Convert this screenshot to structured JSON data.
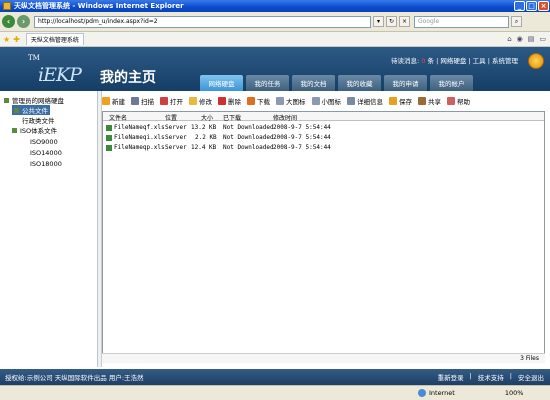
{
  "window": {
    "title": "天纵文档管理系统 - Windows Internet Explorer"
  },
  "browser": {
    "address": "http://localhost/pdm_u/index.aspx?id=2",
    "search_placeholder": "Google",
    "tab_title": "天纵文档管理系统",
    "status_zone": "Internet",
    "zoom": "100%"
  },
  "header": {
    "logo_tm": "TM",
    "logo_brand": "iEKP",
    "logo_home": "我的主页",
    "msg_prefix": "待读消息:",
    "msg_count": "0",
    "msg_suffix": "条",
    "links": "| 网络硬盘 | 工具 | 系统管理",
    "tabs": [
      "网络硬盘",
      "我的任务",
      "我的文档",
      "我的收藏",
      "我的申请",
      "我的帐户"
    ]
  },
  "sidebar": {
    "root": "管理员的网络硬盘",
    "items": [
      "公共文件",
      "行政类文件",
      "ISO体系文件",
      "ISO9000",
      "ISO14000",
      "ISO18000"
    ]
  },
  "toolbar": [
    "新建",
    "扫描",
    "打开",
    "修改",
    "删除",
    "下载",
    "大图标",
    "小图标",
    "详细信息",
    "保存",
    "共享",
    "帮助"
  ],
  "filelist": {
    "columns": [
      "文件名",
      "位置",
      "大小",
      "已下载",
      "修改时间"
    ],
    "rows": [
      {
        "name": "FileNameqf.xls",
        "loc": "Server",
        "size": "13.2 KB",
        "dl": "Not Downloaded",
        "time": "2008-9-7 5:54:44"
      },
      {
        "name": "FileNameqi.xls",
        "loc": "Server",
        "size": "2.2 KB",
        "dl": "Not Downloaded",
        "time": "2008-9-7 5:54:44"
      },
      {
        "name": "FileNameqp.xls",
        "loc": "Server",
        "size": "12.4 KB",
        "dl": "Not Downloaded",
        "time": "2008-9-7 5:54:44"
      }
    ],
    "status": "3 Files"
  },
  "footer": {
    "left": "授权给:示例公司    天纵国际软件出品    用户:王浩然",
    "links": [
      "重新登录",
      "技术支持",
      "安全退出"
    ]
  },
  "colors": {
    "header": "#2c5a86",
    "active_tab": "#3e95d6",
    "title_bar": "#0a4bd0"
  }
}
